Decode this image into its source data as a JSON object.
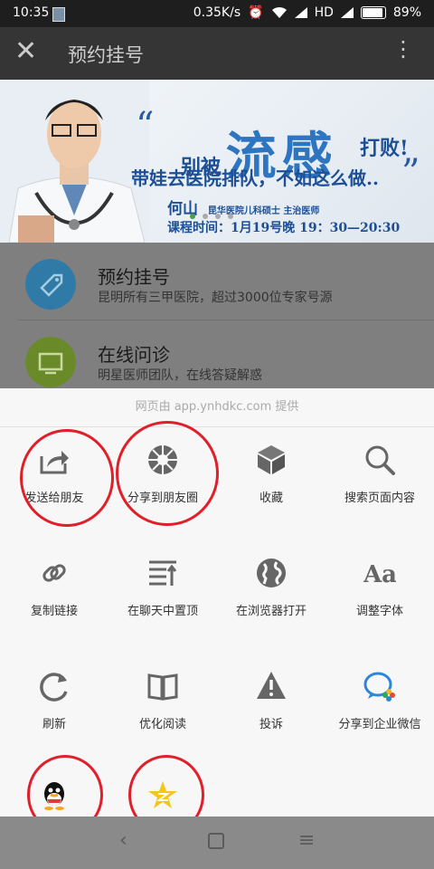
{
  "status_bar": {
    "time": "10:35",
    "network_speed": "0.35K/s",
    "network_type": "HD",
    "battery": "89%"
  },
  "title_bar": {
    "title": "预约挂号",
    "close_icon": "close-icon",
    "more_icon": "more-vertical-icon"
  },
  "banner": {
    "line1_prefix": "别被",
    "line1_big": "流感",
    "line1_suffix": "打败!",
    "line2": "带娃去医院排队，不如这么做..",
    "doctor_name": "何山",
    "doctor_title": "昆华医院儿科硕士 主治医师",
    "schedule": "课程时间：1月19号晚 19：30—20:30"
  },
  "services": [
    {
      "name": "预约挂号",
      "desc": "昆明所有三甲医院，超过3000位专家号源",
      "icon": "tag-icon"
    },
    {
      "name": "在线问诊",
      "desc": "明星医师团队，在线答疑解惑",
      "icon": "screen-icon"
    }
  ],
  "sheet": {
    "provider": "网页由 app.ynhdkc.com 提供",
    "row1": [
      {
        "label": "发送给朋友",
        "icon": "share-forward-icon"
      },
      {
        "label": "分享到朋友圈",
        "icon": "moments-icon"
      },
      {
        "label": "收藏",
        "icon": "cube-icon"
      },
      {
        "label": "搜索页面内容",
        "icon": "search-icon"
      }
    ],
    "row2": [
      {
        "label": "复制链接",
        "icon": "link-icon"
      },
      {
        "label": "在聊天中置顶",
        "icon": "pin-top-icon"
      },
      {
        "label": "在浏览器打开",
        "icon": "globe-icon"
      },
      {
        "label": "调整字体",
        "icon": "font-icon"
      }
    ],
    "row3": [
      {
        "label": "刷新",
        "icon": "refresh-icon"
      },
      {
        "label": "优化阅读",
        "icon": "book-icon"
      },
      {
        "label": "投诉",
        "icon": "warning-icon"
      },
      {
        "label": "分享到企业微信",
        "icon": "wechat-work-icon"
      }
    ],
    "row4": [
      {
        "label": "",
        "icon": "qq-icon"
      },
      {
        "label": "",
        "icon": "qzone-icon"
      }
    ]
  },
  "colors": {
    "annotation_circle": "#e01f2a",
    "icon_gray": "#666666",
    "provider_text": "#aaaaaa"
  }
}
